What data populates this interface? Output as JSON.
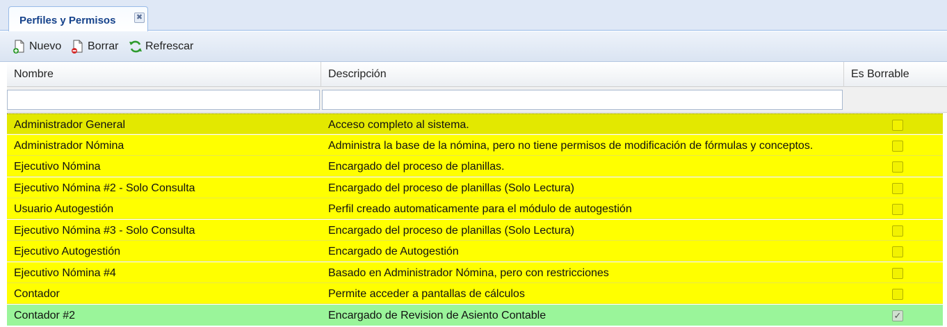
{
  "tab": {
    "title": "Perfiles y Permisos",
    "close_glyph": "✖"
  },
  "toolbar": {
    "new_label": "Nuevo",
    "delete_label": "Borrar",
    "refresh_label": "Refrescar"
  },
  "columns": {
    "name": "Nombre",
    "description": "Descripción",
    "deletable": "Es Borrable"
  },
  "filters": {
    "name_value": "",
    "description_value": ""
  },
  "rows": [
    {
      "name": "Administrador General",
      "description": "Acceso completo al sistema.",
      "deletable": false,
      "check": ""
    },
    {
      "name": "Administrador Nómina",
      "description": "Administra la base de la nómina, pero no tiene permisos de modificación de fórmulas y conceptos.",
      "deletable": false,
      "check": ""
    },
    {
      "name": "Ejecutivo Nómina",
      "description": "Encargado del proceso de planillas.",
      "deletable": false,
      "check": ""
    },
    {
      "name": "Ejecutivo Nómina #2 - Solo Consulta",
      "description": "Encargado del proceso de planillas (Solo Lectura)",
      "deletable": false,
      "check": ""
    },
    {
      "name": "Usuario Autogestión",
      "description": "Perfil creado automaticamente para el módulo de autogestión",
      "deletable": false,
      "check": ""
    },
    {
      "name": "Ejecutivo Nómina #3 - Solo Consulta",
      "description": "Encargado del proceso de planillas (Solo Lectura)",
      "deletable": false,
      "check": ""
    },
    {
      "name": "Ejecutivo Autogestión",
      "description": "Encargado de Autogestión",
      "deletable": false,
      "check": ""
    },
    {
      "name": "Ejecutivo Nómina #4",
      "description": "Basado en Administrador Nómina, pero con restricciones",
      "deletable": false,
      "check": ""
    },
    {
      "name": "Contador",
      "description": "Permite acceder a pantallas de cálculos",
      "deletable": false,
      "check": ""
    },
    {
      "name": "Contador #2",
      "description": "Encargado de Revision de Asiento Contable",
      "deletable": true,
      "check": "✓"
    }
  ],
  "colors": {
    "row_yellow": "#ffff00",
    "row_selected": "#e3e800",
    "row_green": "#9af59a",
    "tab_text": "#15428b"
  },
  "icons": {
    "new": "add-document-icon",
    "delete": "delete-document-icon",
    "refresh": "refresh-icon"
  }
}
